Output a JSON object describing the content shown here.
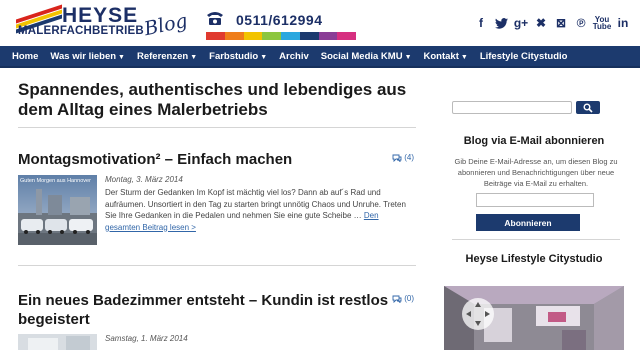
{
  "brand": {
    "name": "HEYSE",
    "sub": "MALERFACHBETRIEB",
    "blog": "Blog",
    "phone": "0511/612994",
    "stripe_colors": [
      "#d9251c",
      "#f2c300",
      "#1c3a6e"
    ],
    "bar_colors": [
      "#e03a2f",
      "#ef7d1a",
      "#f2c300",
      "#8cc63f",
      "#2aa7df",
      "#1c3a6e",
      "#8a3d96",
      "#d62f80"
    ]
  },
  "social": {
    "icons": [
      "facebook-icon",
      "twitter-icon",
      "googleplus-icon",
      "xing-icon",
      "delicious-icon",
      "pinterest-icon",
      "youtube-icon",
      "linkedin-icon"
    ],
    "glyphs": [
      "f",
      "🐦",
      "g+",
      "✖",
      "⊠",
      "℗",
      "You Tube",
      "in"
    ]
  },
  "nav": {
    "items": [
      {
        "label": "Home",
        "caret": ""
      },
      {
        "label": "Was wir lieben",
        "caret": "▼"
      },
      {
        "label": "Referenzen",
        "caret": "▼"
      },
      {
        "label": "Farbstudio",
        "caret": "▼"
      },
      {
        "label": "Archiv",
        "caret": ""
      },
      {
        "label": "Social Media KMU",
        "caret": "▼"
      },
      {
        "label": "Kontakt",
        "caret": "▼"
      },
      {
        "label": "Lifestyle Citystudio",
        "caret": ""
      }
    ]
  },
  "main": {
    "title": "Spannendes, authentisches und lebendiges aus dem Alltag eines Malerbetriebs",
    "posts": [
      {
        "title": "Montagsmotivation² – Einfach machen",
        "comments": "(4)",
        "date": "Montag, 3. März 2014",
        "excerpt": "Der Sturm der Gedanken Im Kopf ist mächtig viel los? Dann ab auf´s Rad und aufräumen. Unsortiert in den Tag zu starten bringt unnötig Chaos und Unruhe. Treten Sie Ihre Gedanken in die Pedalen und nehmen Sie eine gute Scheibe … ",
        "link": "Den gesamten Beitrag lesen >",
        "thumb_caption": "Guten Morgen aus Hannover"
      },
      {
        "title": "Ein neues Badezimmer entsteht – Kundin ist restlos begeistert",
        "comments": "(0)",
        "date": "Samstag, 1. März 2014"
      }
    ]
  },
  "sidebar": {
    "search_placeholder": "",
    "email_title": "Blog via E-Mail abonnieren",
    "email_text": "Gib Deine E-Mail-Adresse an, um diesen Blog zu abonnieren und Benachrichtigungen über neue Beiträge via E-Mail zu erhalten.",
    "email_placeholder": "",
    "subscribe_label": "Abonnieren",
    "studio_title": "Heyse Lifestyle Citystudio"
  }
}
